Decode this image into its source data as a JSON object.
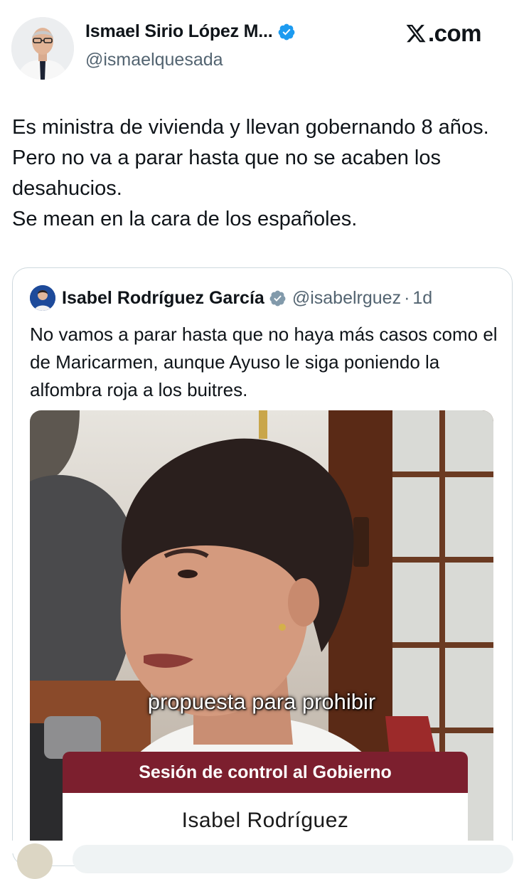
{
  "author": {
    "display_name": "Ismael Sirio López M...",
    "handle": "@ismaelquesada",
    "verified": true
  },
  "brand": {
    "label": ".com",
    "icon": "x-logo-icon"
  },
  "tweet": {
    "text": "Es ministra de vivienda y llevan gobernando 8 años. Pero no va a parar hasta que no se acaben los desahucios.\nSe mean en la cara de los españoles."
  },
  "quote": {
    "display_name": "Isabel Rodríguez García",
    "handle": "@isabelrguez",
    "separator": "·",
    "time": "1d",
    "verified": true,
    "text": "No vamos a parar hasta que no haya más casos como el de Maricarmen, aunque Ayuso le siga poniendo la alfombra roja a los buitres."
  },
  "video": {
    "caption": "propuesta para prohibir",
    "lower_third_title": "Sesión de control al Gobierno",
    "lower_third_name": "Isabel Rodríguez"
  },
  "colors": {
    "verified_blue": "#1d9bf0",
    "lower_third_red": "#7c1f2e",
    "secondary_text": "#536471"
  }
}
